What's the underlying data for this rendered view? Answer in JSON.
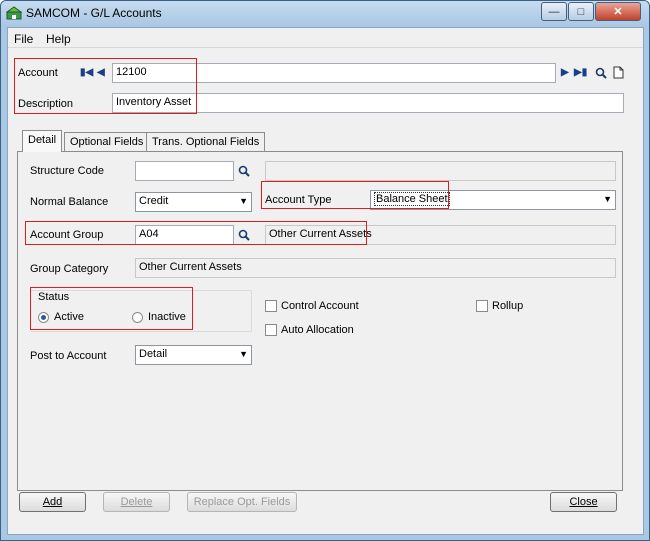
{
  "window": {
    "title": "SAMCOM - G/L Accounts"
  },
  "menu": {
    "file": "File",
    "help": "Help"
  },
  "header": {
    "account_label": "Account",
    "account_value": "12100",
    "description_label": "Description",
    "description_value": "Inventory Asset"
  },
  "tabs": [
    {
      "label": "Detail"
    },
    {
      "label": "Optional Fields"
    },
    {
      "label": "Trans. Optional Fields"
    }
  ],
  "detail": {
    "structure_code_label": "Structure Code",
    "structure_code_value": "",
    "normal_balance_label": "Normal Balance",
    "normal_balance_value": "Credit",
    "account_type_label": "Account Type",
    "account_type_value": "Balance Sheet",
    "account_group_label": "Account Group",
    "account_group_value": "A04",
    "account_group_desc": "Other Current Assets",
    "group_category_label": "Group Category",
    "group_category_value": "Other Current Assets",
    "status_label": "Status",
    "status_active": "Active",
    "status_inactive": "Inactive",
    "control_account": "Control Account",
    "auto_allocation": "Auto Allocation",
    "rollup": "Rollup",
    "post_to_account_label": "Post to Account",
    "post_to_account_value": "Detail"
  },
  "buttons": {
    "add": "Add",
    "delete": "Delete",
    "replace": "Replace Opt. Fields",
    "close": "Close"
  }
}
